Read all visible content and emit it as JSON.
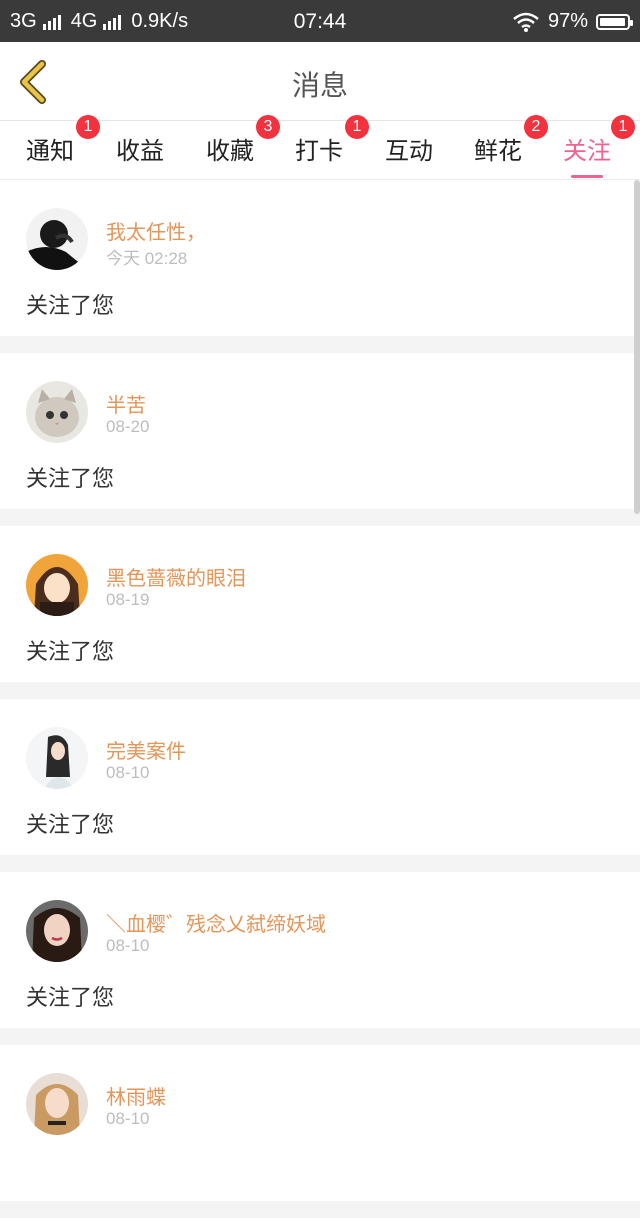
{
  "status_bar": {
    "network1": "3G",
    "network2": "4G",
    "speed": "0.9K/s",
    "time": "07:44",
    "battery": "97%",
    "battery_level": 0.97
  },
  "header": {
    "title": "消息",
    "back_icon": "chevron-left-icon"
  },
  "tabs": [
    {
      "label": "通知",
      "badge": "1"
    },
    {
      "label": "收益",
      "badge": ""
    },
    {
      "label": "收藏",
      "badge": "3"
    },
    {
      "label": "打卡",
      "badge": "1"
    },
    {
      "label": "互动",
      "badge": ""
    },
    {
      "label": "鲜花",
      "badge": "2"
    },
    {
      "label": "关注",
      "badge": "1",
      "active": true
    }
  ],
  "messages": [
    {
      "name": "我太任性，",
      "time": "今天 02:28",
      "text": "关注了您"
    },
    {
      "name": "半苦",
      "time": "08-20",
      "text": "关注了您"
    },
    {
      "name": "黑色蔷薇的眼泪",
      "time": "08-19",
      "text": "关注了您"
    },
    {
      "name": "完美案件",
      "time": "08-10",
      "text": "关注了您"
    },
    {
      "name": "＼血樱゛残念乂弑缔妖域",
      "time": "08-10",
      "text": "关注了您"
    },
    {
      "name": "林雨蝶",
      "time": "08-10",
      "text": ""
    }
  ],
  "colors": {
    "accent": "#f06292",
    "name": "#e3965a",
    "badge": "#f2323f",
    "back_icon": "#d9b33a"
  }
}
